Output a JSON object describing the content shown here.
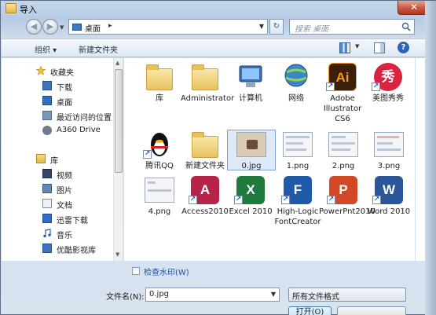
{
  "window": {
    "title": "导入",
    "close_glyph": "✕"
  },
  "nav": {
    "back_glyph": "◀",
    "forward_glyph": "▶",
    "address": "桌面",
    "address_sep": "▸",
    "refresh_glyph": "↻",
    "search_placeholder": "搜索 桌面"
  },
  "toolbar": {
    "organize_label": "组织 ▾",
    "new_folder_label": "新建文件夹",
    "help_glyph": "?"
  },
  "sidebar": {
    "favorites_label": "收藏夹",
    "favorites": [
      {
        "label": "下载",
        "icon": "download-icon"
      },
      {
        "label": "桌面",
        "icon": "desktop-icon"
      },
      {
        "label": "最近访问的位置",
        "icon": "recent-places-icon"
      },
      {
        "label": "A360 Drive",
        "icon": "cloud-drive-icon"
      }
    ],
    "libraries_label": "库",
    "libraries": [
      {
        "label": "视频",
        "icon": "video-icon"
      },
      {
        "label": "图片",
        "icon": "picture-icon"
      },
      {
        "label": "文档",
        "icon": "document-icon"
      },
      {
        "label": "迅雷下载",
        "icon": "thunder-download-icon"
      },
      {
        "label": "音乐",
        "icon": "music-icon"
      },
      {
        "label": "优酷影视库",
        "icon": "youku-icon"
      }
    ]
  },
  "files": [
    {
      "name": "库",
      "kind": "library"
    },
    {
      "name": "Administrator",
      "kind": "user"
    },
    {
      "name": "计算机",
      "kind": "computer"
    },
    {
      "name": "网络",
      "kind": "network"
    },
    {
      "name": "Adobe Illustrator CS6",
      "kind": "ai",
      "tile_text": "Ai"
    },
    {
      "name": "美图秀秀",
      "kind": "meitu",
      "tile_text": "秀"
    },
    {
      "name": "腾讯QQ",
      "kind": "qq"
    },
    {
      "name": "新建文件夹",
      "kind": "folder"
    },
    {
      "name": "0.jpg",
      "kind": "jpg"
    },
    {
      "name": "1.png",
      "kind": "png"
    },
    {
      "name": "2.png",
      "kind": "png"
    },
    {
      "name": "3.png",
      "kind": "png"
    },
    {
      "name": "4.png",
      "kind": "png"
    },
    {
      "name": "Access2010",
      "kind": "access",
      "tile_text": "A"
    },
    {
      "name": "Excel 2010",
      "kind": "excel",
      "tile_text": "X"
    },
    {
      "name": "High-Logic FontCreator",
      "kind": "fontcreator",
      "tile_text": "F"
    },
    {
      "name": "PowerPnt2010",
      "kind": "powerpoint",
      "tile_text": "P"
    },
    {
      "name": "Word 2010",
      "kind": "word",
      "tile_text": "W"
    }
  ],
  "bottom": {
    "watermark_label": "检查水印(W)",
    "filename_label": "文件名(N):",
    "filename_value": "0.jpg",
    "filetype_value": "所有文件格式",
    "open_label": "打开(O)"
  },
  "colors": {
    "ai_tile": "#3b1f08",
    "ai_text": "#f59a1c",
    "meitu_tile": "#d9233f",
    "access_tile": "#b7244a",
    "excel_tile": "#1f7a3e",
    "font_tile": "#1f5aa8",
    "ppt_tile": "#d24726",
    "word_tile": "#2b579a",
    "selection": "#dde9f7"
  }
}
